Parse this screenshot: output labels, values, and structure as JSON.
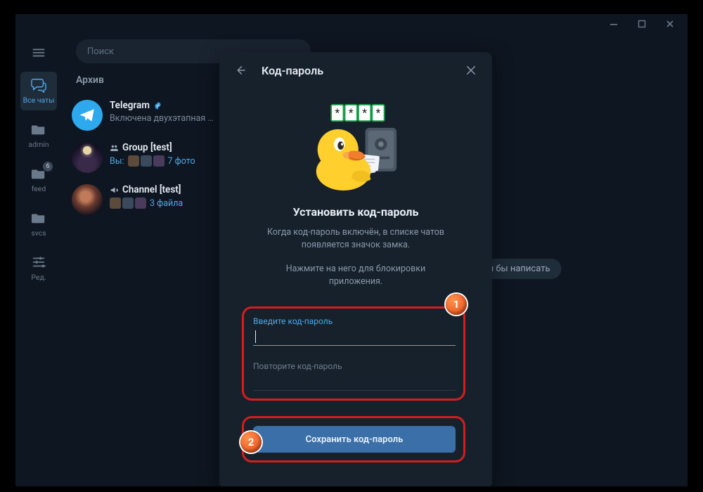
{
  "window": {},
  "rail": {
    "all_chats": "Все чаты",
    "admin": "admin",
    "feed": "feed",
    "feed_badge": "6",
    "svcs": "svcs",
    "edit": "Ред."
  },
  "search": {
    "placeholder": "Поиск"
  },
  "archive_header": "Архив",
  "chats": [
    {
      "title": "Telegram",
      "subtitle": "Включена двухэтапная …"
    },
    {
      "title": "Group [test]",
      "you_prefix": "Вы:",
      "count": "7 фото"
    },
    {
      "title": "Channel [test]",
      "count": "3 файла"
    }
  ],
  "main_hint": "у хотели бы написать",
  "modal": {
    "header_title": "Код-пароль",
    "big_title": "Установить код-пароль",
    "desc1": "Когда код-пароль включён, в списке чатов появляется значок замка.",
    "desc2": "Нажмите на него для блокировки приложения.",
    "label_enter": "Введите код-пароль",
    "label_repeat": "Повторите код-пароль",
    "save": "Сохранить код-пароль"
  },
  "markers": {
    "one": "1",
    "two": "2"
  }
}
